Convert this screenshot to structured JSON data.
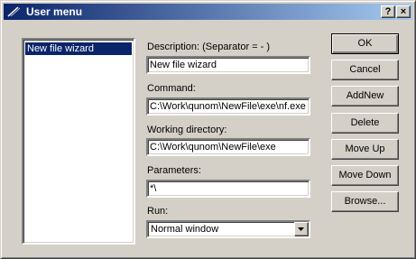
{
  "window": {
    "title": "User menu"
  },
  "titlebar": {
    "help_label": "?",
    "close_label": "×"
  },
  "menu_list": {
    "items": [
      "New file wizard"
    ]
  },
  "fields": {
    "description": {
      "label": "Description: (Separator = - )",
      "value": "New file wizard"
    },
    "command": {
      "label": "Command:",
      "value": "C:\\Work\\qunom\\NewFile\\exe\\nf.exe"
    },
    "working_directory": {
      "label": "Working directory:",
      "value": "C:\\Work\\qunom\\NewFile\\exe"
    },
    "parameters": {
      "label": "Parameters:",
      "value": "*\\"
    },
    "run": {
      "label": "Run:",
      "value": "Normal window"
    }
  },
  "buttons": {
    "ok": "OK",
    "cancel": "Cancel",
    "add_new": "AddNew",
    "delete": "Delete",
    "move_up": "Move Up",
    "move_down": "Move Down",
    "browse": "Browse..."
  },
  "colors": {
    "titlebar_start": "#0a246a",
    "titlebar_end": "#a6caf0",
    "selection": "#0a246a",
    "face": "#d4d0c8"
  }
}
